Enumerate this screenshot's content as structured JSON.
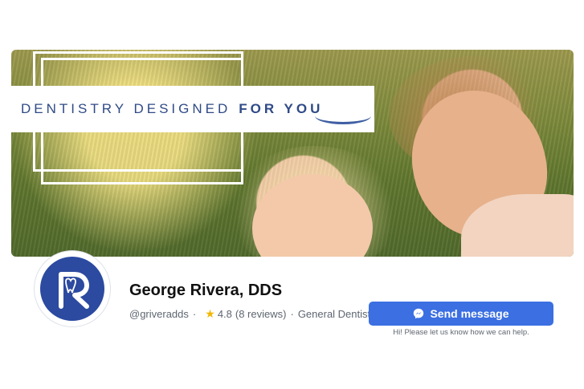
{
  "cover": {
    "headline_left": "DENTISTRY DESIGNED",
    "headline_right": "FOR YOU"
  },
  "profile": {
    "name": "George Rivera, DDS",
    "handle": "@griveradds",
    "rating": "4.8",
    "reviews": "(8 reviews)",
    "category": "General Dentist"
  },
  "actions": {
    "send_message_label": "Send message",
    "send_message_hint": "Hi! Please let us know how we can help."
  },
  "icons": {
    "logo": "r-tooth-logo-icon",
    "star": "star-icon",
    "messenger": "messenger-icon"
  },
  "colors": {
    "brand_blue": "#2b4aa0",
    "button_blue": "#3b6fe2",
    "star_gold": "#f2b600",
    "headline_blue": "#2f4a86"
  }
}
